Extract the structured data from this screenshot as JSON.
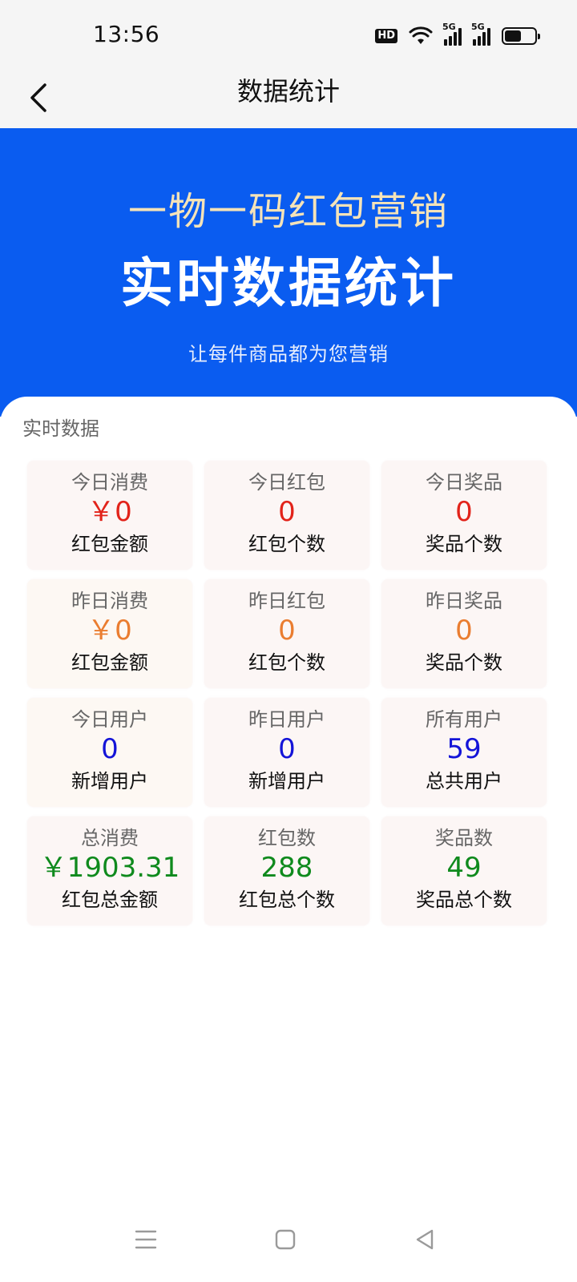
{
  "status_bar": {
    "time": "13:56",
    "hd_label": "HD",
    "sim1_label": "5G",
    "sim2_label": "5G",
    "battery_level": 0.55
  },
  "nav": {
    "title": "数据统计",
    "back_icon": "chevron-left-icon"
  },
  "hero": {
    "line1": "一物一码红包营销",
    "line2": "实时数据统计",
    "subtitle": "让每件商品都为您营销"
  },
  "section": {
    "title": "实时数据"
  },
  "stats": [
    {
      "title": "今日消费",
      "value": "￥0",
      "label": "红包金额",
      "color": "#e2231a"
    },
    {
      "title": "今日红包",
      "value": "0",
      "label": "红包个数",
      "color": "#e2231a"
    },
    {
      "title": "今日奖品",
      "value": "0",
      "label": "奖品个数",
      "color": "#e2231a"
    },
    {
      "title": "昨日消费",
      "value": "￥0",
      "label": "红包金额",
      "color": "#ea7d30"
    },
    {
      "title": "昨日红包",
      "value": "0",
      "label": "红包个数",
      "color": "#ea7d30"
    },
    {
      "title": "昨日奖品",
      "value": "0",
      "label": "奖品个数",
      "color": "#ea7d30"
    },
    {
      "title": "今日用户",
      "value": "0",
      "label": "新增用户",
      "color": "#1414d8"
    },
    {
      "title": "昨日用户",
      "value": "0",
      "label": "新增用户",
      "color": "#1414d8"
    },
    {
      "title": "所有用户",
      "value": "59",
      "label": "总共用户",
      "color": "#1414d8"
    },
    {
      "title": "总消费",
      "value": "￥1903.31",
      "label": "红包总金额",
      "color": "#0f8a1d"
    },
    {
      "title": "红包数",
      "value": "288",
      "label": "红包总个数",
      "color": "#0f8a1d"
    },
    {
      "title": "奖品数",
      "value": "49",
      "label": "奖品总个数",
      "color": "#0f8a1d"
    }
  ],
  "colors": {
    "hero_bg": "#0a5cf0",
    "hero_line1": "#f5e3b8"
  },
  "bottom_nav": {
    "icons": [
      "menu-icon",
      "home-square-icon",
      "back-triangle-icon"
    ]
  }
}
